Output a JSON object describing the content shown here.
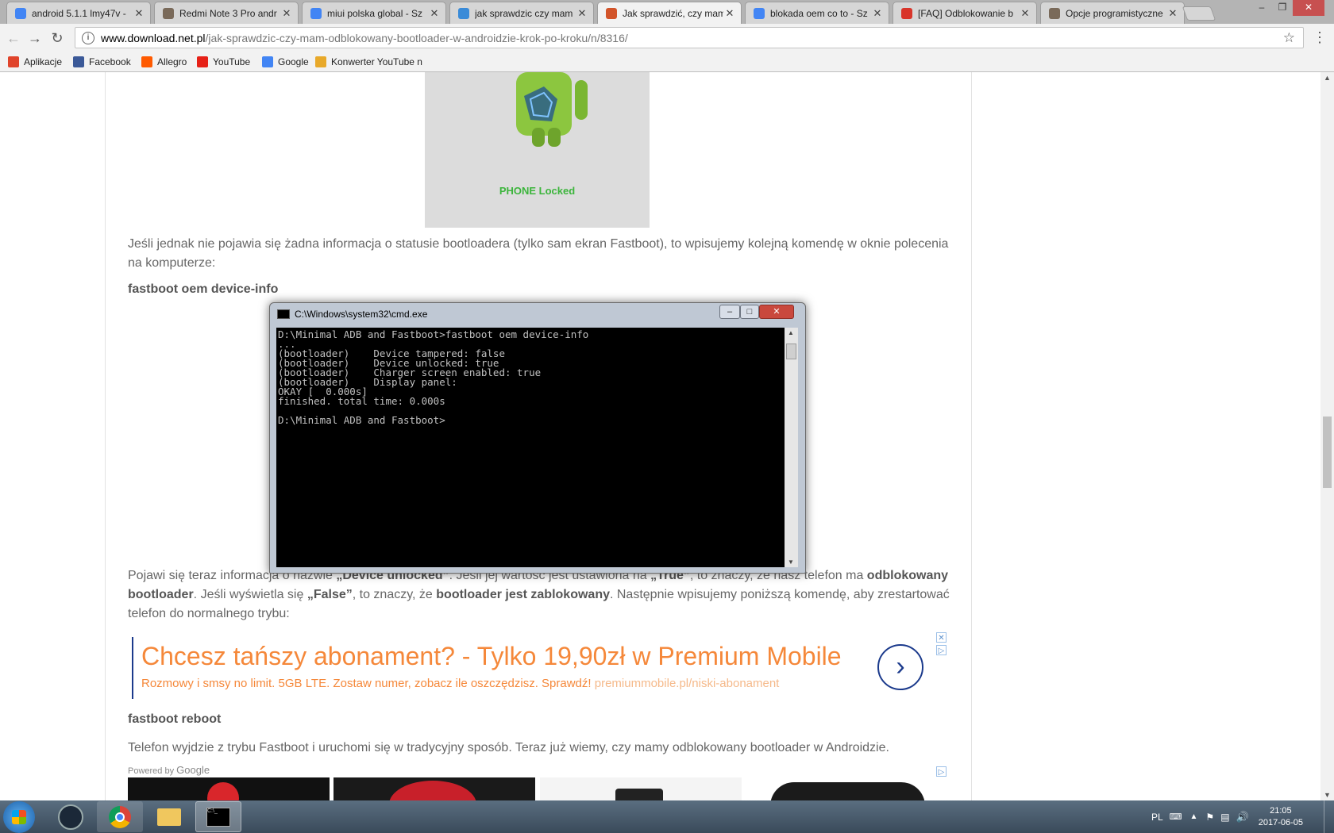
{
  "tabs": [
    {
      "title": "android 5.1.1 lmy47v - ",
      "icon": "google-icon",
      "color": "#4285f4",
      "active": false
    },
    {
      "title": "Redmi Note 3 Pro andr",
      "icon": "miui-forum-icon",
      "color": "#7a6a5a",
      "active": false
    },
    {
      "title": "miui polska global - Sz",
      "icon": "google-icon",
      "color": "#4285f4",
      "active": false
    },
    {
      "title": "jak sprawdzic czy mam",
      "icon": "globe-icon",
      "color": "#3a8bd8",
      "active": false
    },
    {
      "title": "Jak sprawdzić, czy mam",
      "icon": "download-net-icon",
      "color": "#d2542a",
      "active": true
    },
    {
      "title": "blokada oem co to - Sz",
      "icon": "google-icon",
      "color": "#4285f4",
      "active": false
    },
    {
      "title": "[FAQ] Odblokowanie b",
      "icon": "faq-icon",
      "color": "#d8352a",
      "active": false
    },
    {
      "title": "Opcje programistyczne",
      "icon": "miui-forum-icon",
      "color": "#7a6a5a",
      "active": false
    }
  ],
  "address": {
    "host": "www.download.net.pl",
    "path": "/jak-sprawdzic-czy-mam-odblokowany-bootloader-w-androidzie-krok-po-kroku/n/8316/"
  },
  "bookmarks": [
    {
      "label": "Aplikacje",
      "icon": "apps-grid-icon",
      "color": "#e0442b"
    },
    {
      "label": "Facebook",
      "icon": "facebook-icon",
      "color": "#3b5998"
    },
    {
      "label": "Allegro",
      "icon": "allegro-icon",
      "color": "#ff5a00"
    },
    {
      "label": "YouTube",
      "icon": "youtube-icon",
      "color": "#e62117"
    },
    {
      "label": "Google",
      "icon": "google-icon",
      "color": "#4285f4"
    },
    {
      "label": "Konwerter YouTube n",
      "icon": "converter-icon",
      "color": "#e8a92a"
    }
  ],
  "article": {
    "image_caption": "PHONE Locked",
    "para1": "Jeśli jednak nie pojawia się żadna informacja o statusie bootloadera (tylko sam ekran Fastboot), to wpisujemy kolejną komendę w oknie polecenia na komputerze:",
    "command1": "fastboot oem device-info",
    "para2_start": "Pojawi się teraz informacja o nazwie ",
    "para2_b1": "„Device unlocked”",
    "para2_mid1": ". Jeśli jej wartość jest ustawiona na ",
    "para2_b2": "„True”",
    "para2_mid2": ", to znaczy, że nasz telefon ma ",
    "para2_b3": "odblokowany bootloader",
    "para2_mid3": ". Jeśli wyświetla się ",
    "para2_b4": "„False”",
    "para2_mid4": ", to znaczy, że ",
    "para2_b5": "bootloader jest zablokowany",
    "para2_end": ". Następnie wpisujemy poniższą komendę, aby zrestartować telefon do normalnego trybu:",
    "command2": "fastboot reboot",
    "para3": "Telefon wyjdzie z trybu Fastboot i uruchomi się w tradycyjny sposób. Teraz już wiemy, czy mamy odblokowany bootloader w Androidzie.",
    "powered_by": "Powered by",
    "powered_google": "Google"
  },
  "ad": {
    "headline": "Chcesz tańszy abonament? - Tylko 19,90zł w Premium Mobile",
    "description": "Rozmowy i smsy no limit. 5GB LTE. Zostaw numer, zobacz ile oszczędzisz. Sprawdź!",
    "url": "premiummobile.pl/niski-abonament"
  },
  "cmd": {
    "title": "C:\\Windows\\system32\\cmd.exe",
    "output": "D:\\Minimal ADB and Fastboot>fastboot oem device-info\n...\n(bootloader)    Device tampered: false\n(bootloader)    Device unlocked: true\n(bootloader)    Charger screen enabled: true\n(bootloader)    Display panel:\nOKAY [  0.000s]\nfinished. total time: 0.000s\n\nD:\\Minimal ADB and Fastboot>"
  },
  "taskbar": {
    "language": "PL",
    "time": "21:05",
    "date": "2017-06-05"
  }
}
